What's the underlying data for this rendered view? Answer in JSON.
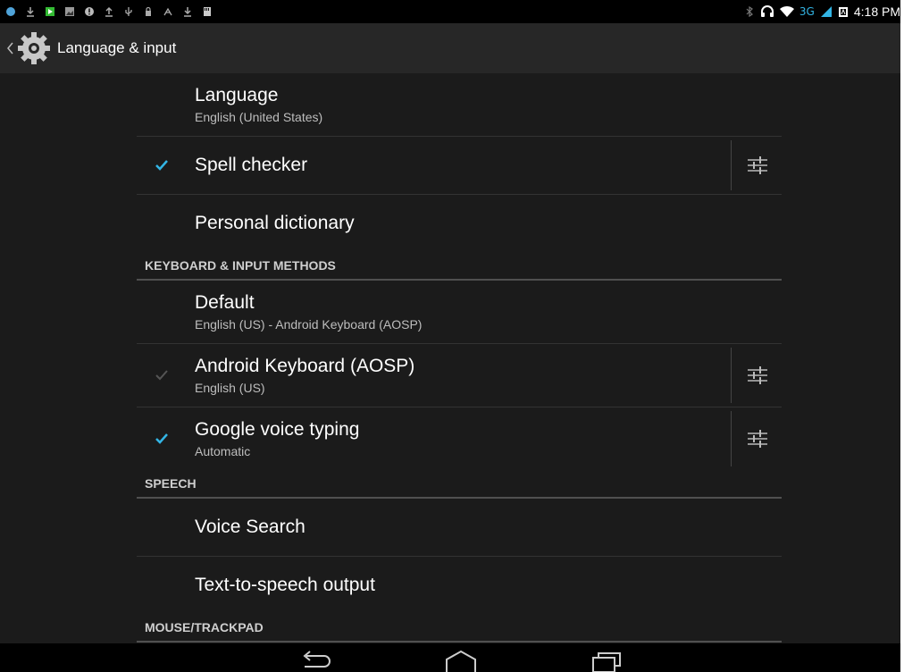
{
  "statusbar": {
    "network": "3G",
    "time": "4:18 PM"
  },
  "actionbar": {
    "title": "Language & input"
  },
  "items": {
    "language": {
      "primary": "Language",
      "secondary": "English (United States)"
    },
    "spell_checker": {
      "primary": "Spell checker",
      "checked": true
    },
    "personal_dictionary": {
      "primary": "Personal dictionary"
    },
    "default": {
      "primary": "Default",
      "secondary": "English (US) - Android Keyboard (AOSP)"
    },
    "android_keyboard": {
      "primary": "Android Keyboard (AOSP)",
      "secondary": "English (US)",
      "checked": true,
      "disabled": true
    },
    "google_voice_typing": {
      "primary": "Google voice typing",
      "secondary": "Automatic",
      "checked": true
    },
    "voice_search": {
      "primary": "Voice Search"
    },
    "tts_output": {
      "primary": "Text-to-speech output"
    }
  },
  "headers": {
    "keyboard": "KEYBOARD & INPUT METHODS",
    "speech": "SPEECH",
    "mouse": "MOUSE/TRACKPAD"
  },
  "colors": {
    "accent": "#33b5e5",
    "background": "#1b1b1b",
    "actionbar": "#272727"
  }
}
